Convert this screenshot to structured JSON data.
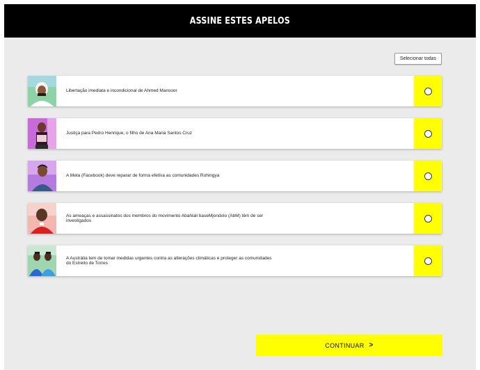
{
  "header": {
    "title": "ASSINE ESTES APELOS"
  },
  "select_all": {
    "label": "Selecionar todas"
  },
  "appeals": [
    {
      "text": "Libertação imediata e incondicional de Ahmed Mansoor",
      "photo": "ahmed-mansoor-photo"
    },
    {
      "text": "Justiça para Pedro Henrique, o filho de Ana Maria Santos Cruz",
      "photo": "ana-maria-santos-cruz-photo"
    },
    {
      "text": "A Meta (Facebook) deve reparar de forma efetiva as comunidades Rohingya",
      "photo": "rohingya-person-photo"
    },
    {
      "text": "As ameaças e assassinatos dos membros do movimento Abahlali baseMjondolo (AbM) têm de ser investigados",
      "photo": "abahlali-member-photo"
    },
    {
      "text": "A Austrália tem de tomar medidas urgentes contra as alterações climáticas e proteger as comunidades do Estreito de Torres",
      "photo": "torres-strait-people-photo"
    }
  ],
  "continue": {
    "label": "CONTINUAR",
    "icon": "chevron-right-icon",
    "glyph": ">"
  },
  "colors": {
    "accent": "#ffff00",
    "header_bg": "#000000",
    "panel_bg": "#ebebeb"
  }
}
